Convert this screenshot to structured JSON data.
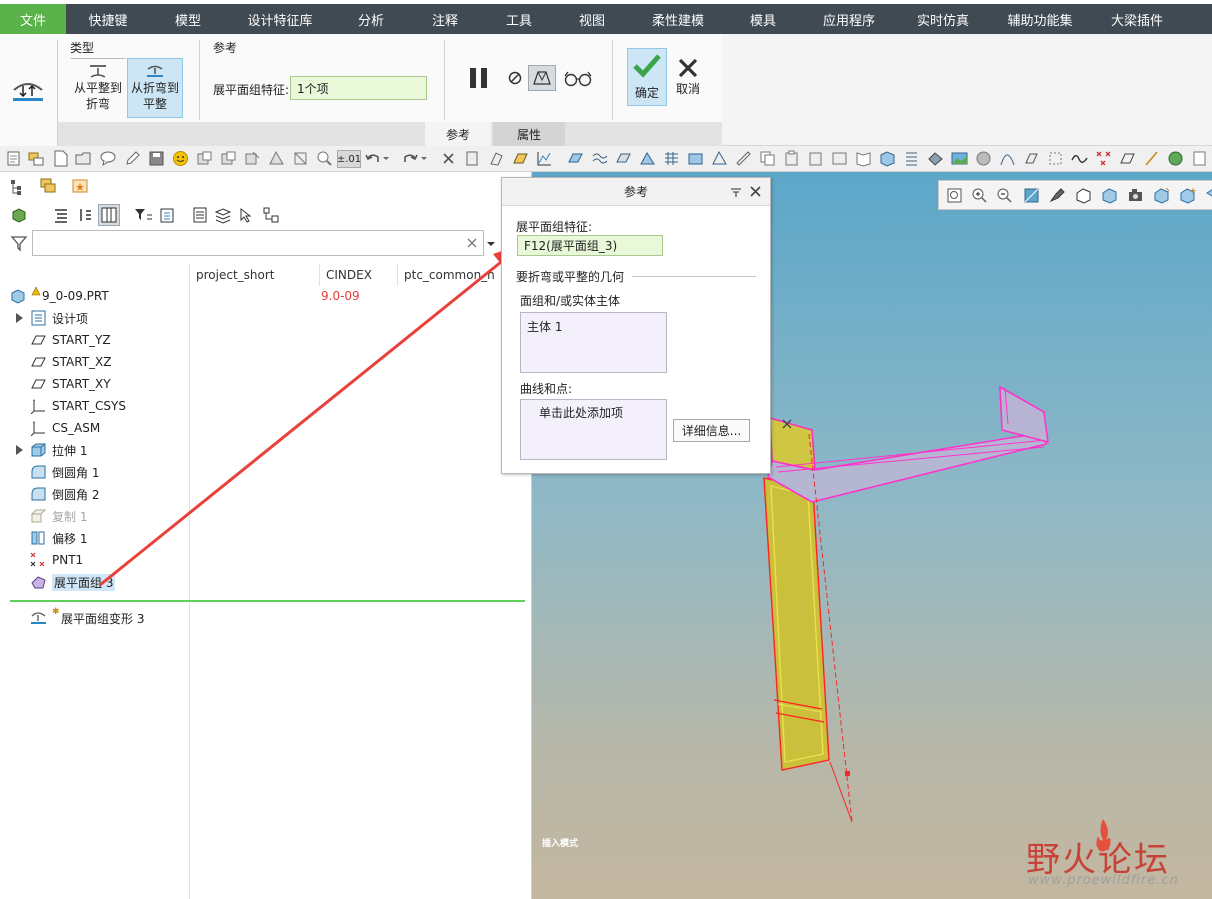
{
  "menu": {
    "items": [
      {
        "label": "文件",
        "active": true
      },
      {
        "label": "快捷键"
      },
      {
        "label": "模型"
      },
      {
        "label": "设计特征库"
      },
      {
        "label": "分析"
      },
      {
        "label": "注释"
      },
      {
        "label": "工具"
      },
      {
        "label": "视图"
      },
      {
        "label": "柔性建模"
      },
      {
        "label": "模具"
      },
      {
        "label": "应用程序"
      },
      {
        "label": "实时仿真"
      },
      {
        "label": "辅助功能集"
      },
      {
        "label": "大梁插件"
      }
    ]
  },
  "ribbon": {
    "type_group_title": "类型",
    "btn_flat_to_bend_l1": "从平整到",
    "btn_flat_to_bend_l2": "折弯",
    "btn_bend_to_flat_l1": "从折弯到",
    "btn_bend_to_flat_l2": "平整",
    "ref_group_title": "参考",
    "field_label": "展平面组特征:",
    "field_value": "1个项",
    "ok_label": "确定",
    "cancel_label": "取消",
    "tab_reference": "参考",
    "tab_properties": "属性"
  },
  "toolbar": {
    "precision_label": "±.01"
  },
  "tree": {
    "col_project_short": "project_short",
    "col_cindex": "CINDEX",
    "col_ptc_common": "ptc_common_n",
    "root_name": "9_0-09.PRT",
    "root_cindex": "9.0-09",
    "items": [
      {
        "label": "设计项",
        "icon": "design-items-icon"
      },
      {
        "label": "START_YZ",
        "icon": "datum-plane-icon"
      },
      {
        "label": "START_XZ",
        "icon": "datum-plane-icon"
      },
      {
        "label": "START_XY",
        "icon": "datum-plane-icon"
      },
      {
        "label": "START_CSYS",
        "icon": "csys-icon"
      },
      {
        "label": "CS_ASM",
        "icon": "csys-icon"
      },
      {
        "label": "拉伸 1",
        "icon": "extrude-icon"
      },
      {
        "label": "倒圆角 1",
        "icon": "round-icon"
      },
      {
        "label": "倒圆角 2",
        "icon": "round-icon"
      },
      {
        "label": "复制 1",
        "icon": "copy-icon"
      },
      {
        "label": "偏移 1",
        "icon": "offset-icon"
      },
      {
        "label": "PNT1",
        "icon": "datum-point-icon"
      },
      {
        "label": "展平面组 3",
        "icon": "flatten-quilt-icon"
      }
    ],
    "inserted_item": "展平面组变形 3"
  },
  "ref_panel": {
    "title": "参考",
    "field_label": "展平面组特征:",
    "field_value": "F12(展平面组_3)",
    "section_title": "要折弯或平整的几何",
    "quilts_label": "面组和/或实体主体",
    "quilts_item": "主体 1",
    "curves_label": "曲线和点:",
    "curves_placeholder": "单击此处添加项",
    "details_button": "详细信息..."
  },
  "viewport": {
    "insert_mode_label": "插入模式"
  },
  "watermark": {
    "title": "野火论坛",
    "url": "www.proewildfire.cn"
  },
  "colors": {
    "menubar": "#3f4a53",
    "file_tab": "#59b34a",
    "selected_geometry": "#c8c23f",
    "highlight_edges": "#ff33cc",
    "annotation_arrow": "#e8403a"
  }
}
